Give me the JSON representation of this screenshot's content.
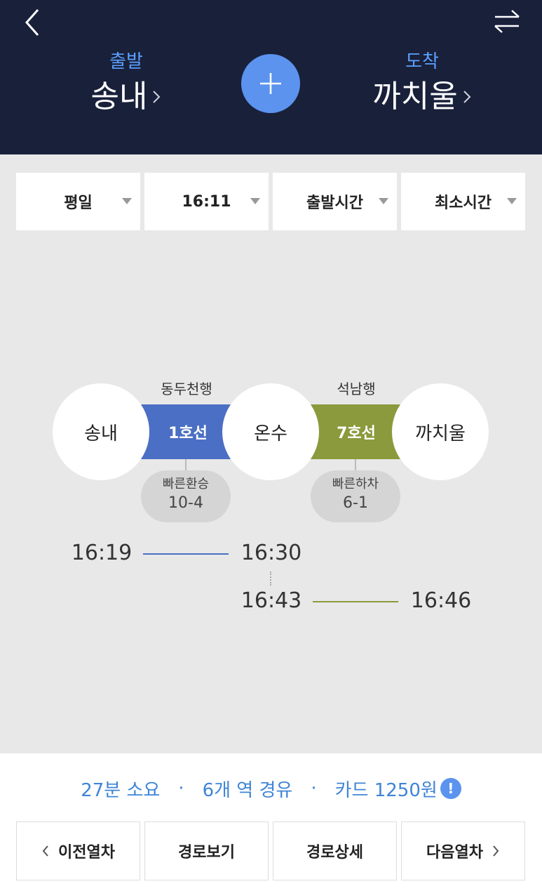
{
  "header": {
    "departure_caption": "출발",
    "departure_station": "송내",
    "arrival_caption": "도착",
    "arrival_station": "까치울"
  },
  "filters": [
    {
      "label": "평일"
    },
    {
      "label": "16:11"
    },
    {
      "label": "출발시간"
    },
    {
      "label": "최소시간"
    }
  ],
  "route": {
    "stations": [
      "송내",
      "온수",
      "까치울"
    ],
    "segments": [
      {
        "line": "1호선",
        "direction": "동두천행",
        "color": "#4a6fc4",
        "hint_title": "빠른환승",
        "hint_value": "10-4",
        "depart": "16:19",
        "arrive": "16:30"
      },
      {
        "line": "7호선",
        "direction": "석남행",
        "color": "#8a9a3c",
        "hint_title": "빠른하차",
        "hint_value": "6-1",
        "depart": "16:43",
        "arrive": "16:46"
      }
    ]
  },
  "summary": {
    "duration": "27분 소요",
    "stops": "6개 역 경유",
    "fare": "카드 1250원",
    "separator": "·"
  },
  "actions": {
    "prev": "이전열차",
    "route_view": "경로보기",
    "route_detail": "경로상세",
    "next": "다음열차"
  },
  "colors": {
    "header_bg": "#19203a",
    "accent": "#5b93ee",
    "caption": "#5aa0ff",
    "summary_text": "#3f85d6"
  }
}
